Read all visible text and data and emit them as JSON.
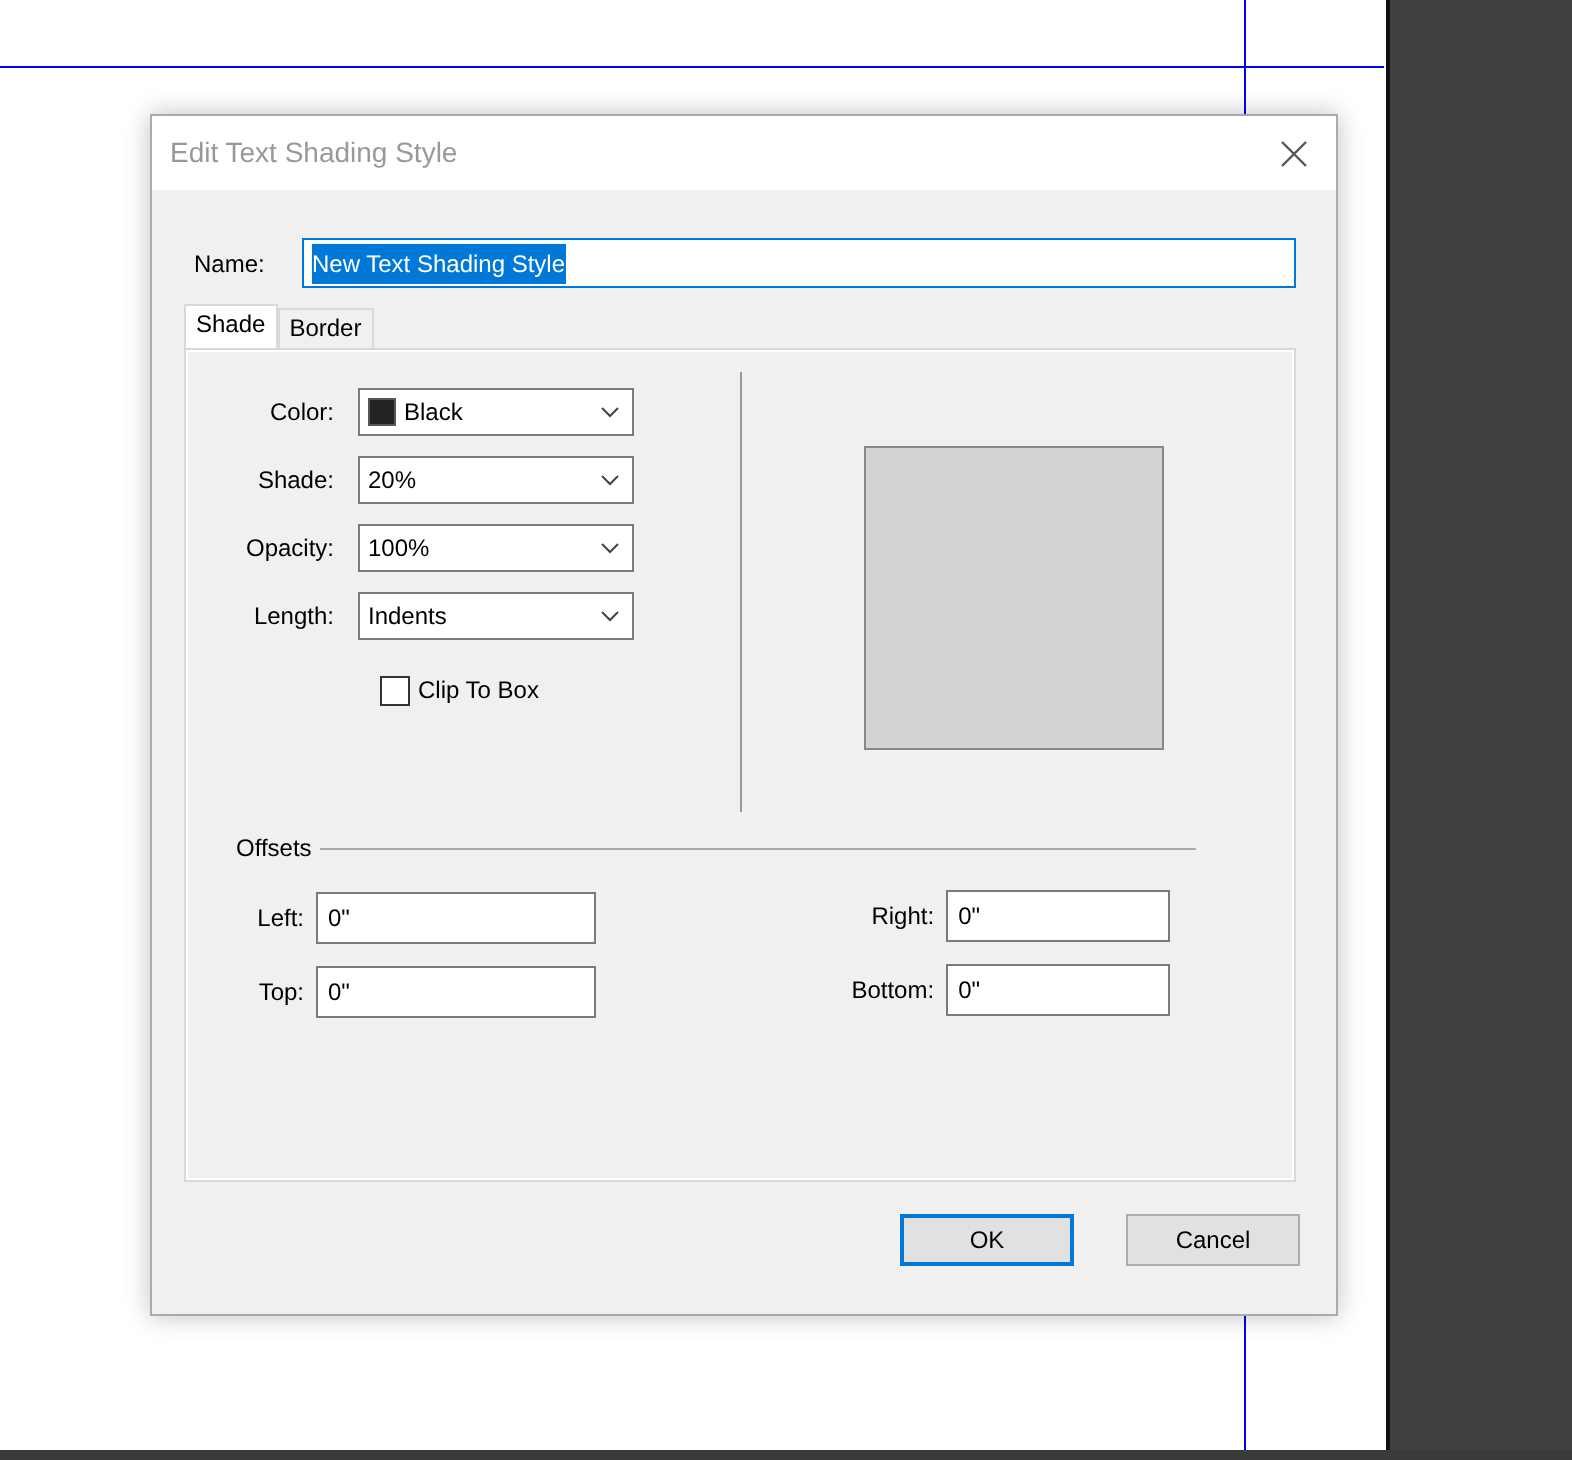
{
  "dialog": {
    "title": "Edit Text Shading Style"
  },
  "name_field": {
    "label": "Name:",
    "value": "New Text Shading Style",
    "text_selected": true
  },
  "tabs": [
    {
      "label": "Shade",
      "selected": true
    },
    {
      "label": "Border",
      "selected": false
    }
  ],
  "settings": [
    {
      "kind": "color-select",
      "label": "Color:",
      "value": "Black",
      "color": "#222222"
    },
    {
      "kind": "select",
      "label": "Shade:",
      "value": "20%"
    },
    {
      "kind": "select",
      "label": "Opacity:",
      "value": "100%"
    },
    {
      "kind": "select",
      "label": "Length:",
      "value": "Indents"
    }
  ],
  "clip_to_box": {
    "label": "Clip To Box",
    "checked": false
  },
  "offsets": {
    "label": "Offsets",
    "fields": [
      {
        "label": "Left:",
        "value": "0\""
      },
      {
        "label": "Right:",
        "value": "0\""
      },
      {
        "label": "Top:",
        "value": "0\""
      },
      {
        "label": "Bottom:",
        "value": "0\""
      }
    ]
  },
  "buttons": [
    {
      "label": "OK",
      "default": true
    },
    {
      "label": "Cancel",
      "default": false
    }
  ]
}
